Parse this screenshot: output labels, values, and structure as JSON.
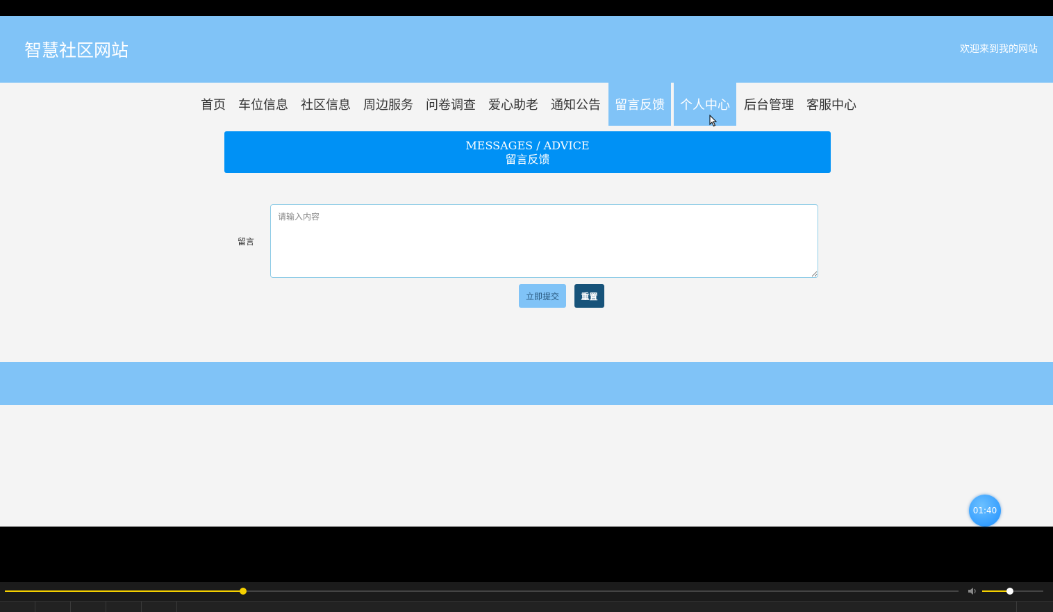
{
  "header": {
    "site_title": "智慧社区网站",
    "welcome": "欢迎来到我的网站"
  },
  "nav": {
    "items": [
      {
        "label": "首页"
      },
      {
        "label": "车位信息"
      },
      {
        "label": "社区信息"
      },
      {
        "label": "周边服务"
      },
      {
        "label": "问卷调查"
      },
      {
        "label": "爱心助老"
      },
      {
        "label": "通知公告"
      },
      {
        "label": "留言反馈",
        "active": true
      },
      {
        "label": "个人中心",
        "active": true
      },
      {
        "label": "后台管理"
      },
      {
        "label": "客服中心"
      }
    ]
  },
  "banner": {
    "title_en": "MESSAGES / ADVICE",
    "title_cn": "留言反馈"
  },
  "form": {
    "label": "留言",
    "placeholder": "请输入内容",
    "value": "",
    "submit_label": "立即提交",
    "reset_label": "重置"
  },
  "timer": {
    "text": "01:40"
  },
  "player": {
    "progress": 0.25,
    "volume": 0.45
  },
  "colors": {
    "header_bg": "#80c3f7",
    "banner_bg": "#0091f5",
    "reset_bg": "#17537a",
    "seek_color": "#f5d000"
  }
}
